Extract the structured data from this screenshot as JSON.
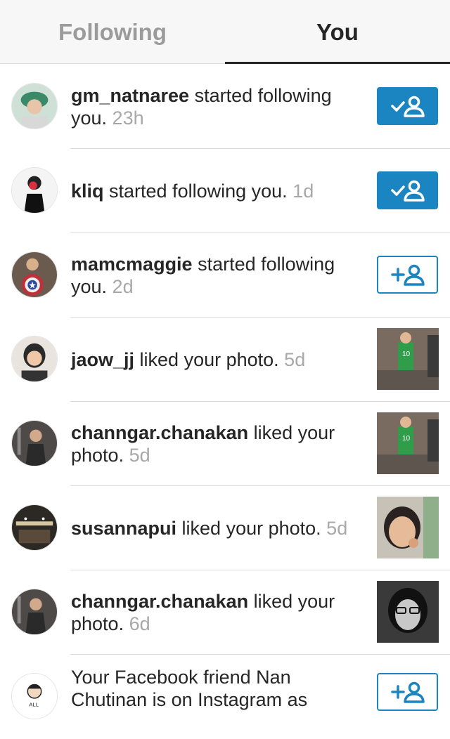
{
  "tabs": {
    "following": "Following",
    "you": "You"
  },
  "notifications": [
    {
      "username": "gm_natnaree",
      "action": " started following you. ",
      "time": "23h",
      "type": "follow",
      "button": "following"
    },
    {
      "username": "kliq",
      "action": " started following you. ",
      "time": "1d",
      "type": "follow",
      "button": "following"
    },
    {
      "username": "mamcmaggie",
      "action": " started following you. ",
      "time": "2d",
      "type": "follow",
      "button": "follow"
    },
    {
      "username": "jaow_jj",
      "action": " liked your photo. ",
      "time": "5d",
      "type": "like"
    },
    {
      "username": "channgar.chanakan",
      "action": " liked your photo. ",
      "time": "5d",
      "type": "like"
    },
    {
      "username": "susannapui",
      "action": " liked your photo. ",
      "time": "5d",
      "type": "like"
    },
    {
      "username": "channgar.chanakan",
      "action": " liked your photo. ",
      "time": "6d",
      "type": "like"
    },
    {
      "prefix": "Your Facebook friend Nan Chutinan is on Instagram as",
      "type": "suggestion",
      "button": "follow",
      "avatar_text": "ALL"
    }
  ],
  "colors": {
    "accent": "#1a85c1",
    "muted": "#a8a8a8",
    "tab_inactive": "#9b9b9b"
  },
  "icons": {
    "following": "person-check-icon",
    "follow": "person-plus-icon"
  }
}
